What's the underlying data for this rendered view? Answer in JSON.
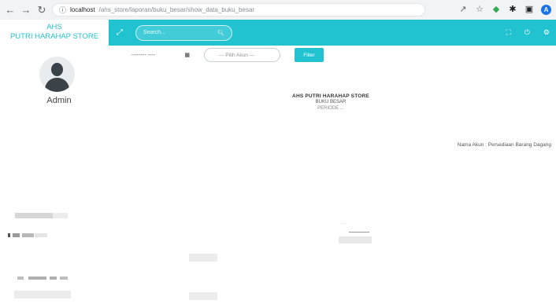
{
  "browser": {
    "back_icon": "arrow-left-icon",
    "forward_icon": "arrow-right-icon",
    "reload_icon": "reload-icon",
    "url_host": "localhost",
    "url_path": "/ahs_store/laporan/buku_besar/show_data_buku_besar",
    "profile_initial": "A"
  },
  "brand": {
    "line1": "AHS",
    "line2": "PUTRI HARAHAP STORE"
  },
  "topbar": {
    "search_placeholder": "Search...",
    "search_icon": "search-icon",
    "color": "#22c3d1"
  },
  "sidebar": {
    "user_name": "Admin"
  },
  "filter": {
    "date_value": "-------- ----",
    "akun_placeholder": "--- Pilih Akun ---",
    "button_label": "Filter"
  },
  "report": {
    "title": "AHS PUTRI HARAHAP STORE",
    "subtitle": "BUKU BESAR",
    "period": "PERIODE ...",
    "account_line": "Nama Akun : Persediaan Barang Dagang"
  },
  "remnants": {
    "dots": "...."
  }
}
